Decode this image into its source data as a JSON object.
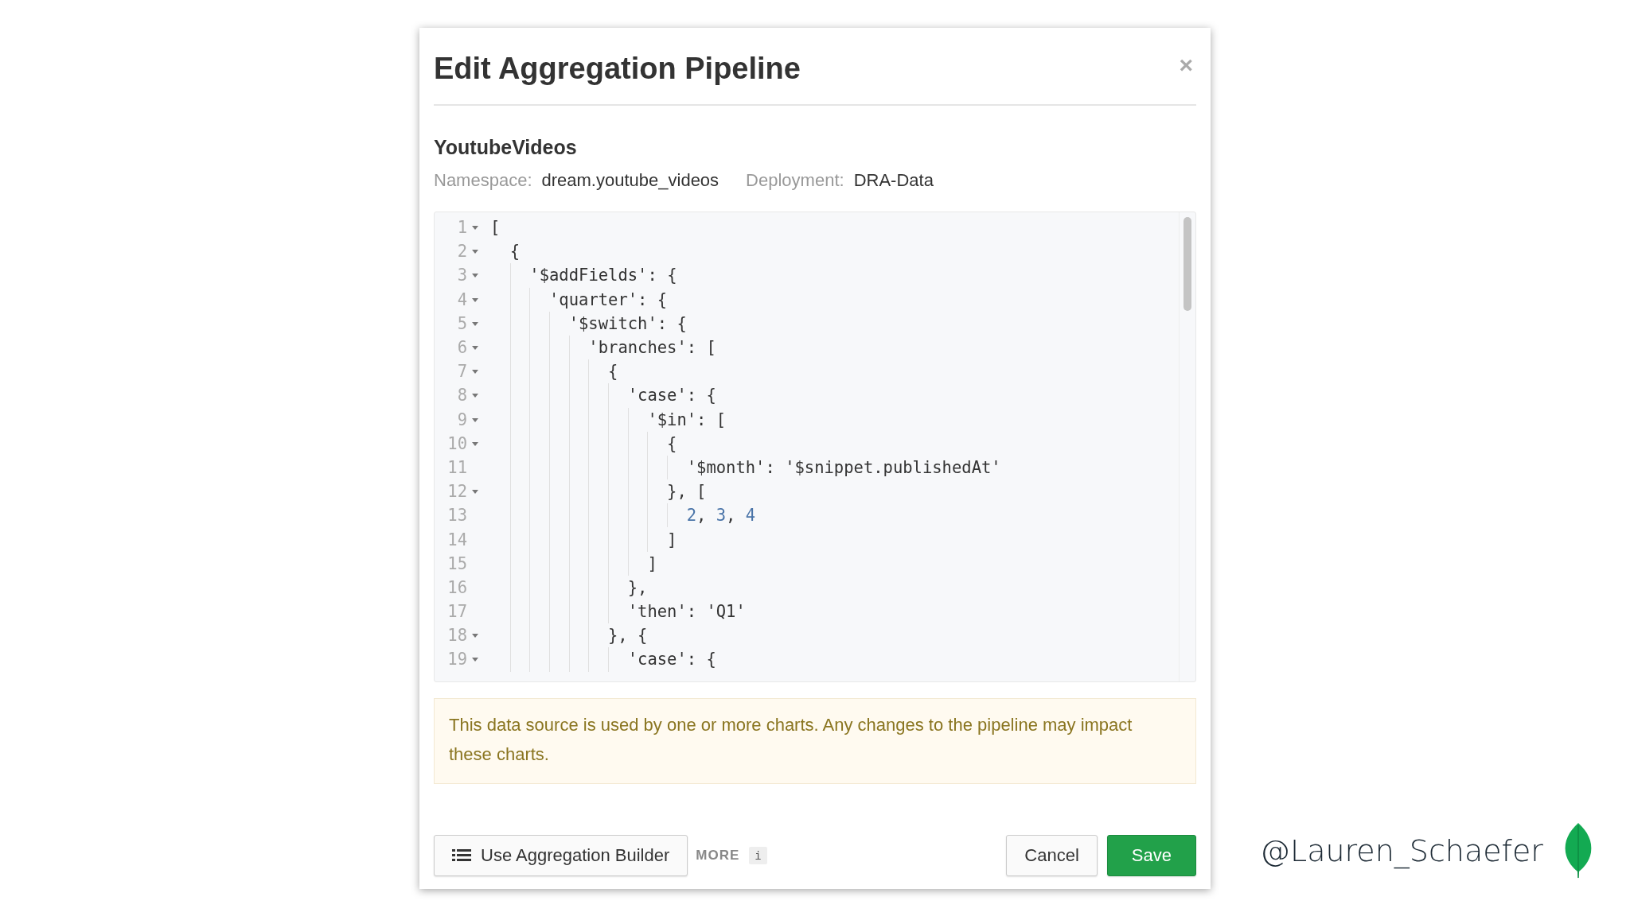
{
  "dialog": {
    "title": "Edit Aggregation Pipeline",
    "close": "×",
    "data_source": {
      "name": "YoutubeVideos",
      "fields": [
        {
          "label": "Namespace:",
          "value": "dream.youtube_videos"
        },
        {
          "label": "Deployment:",
          "value": "DRA-Data"
        }
      ]
    },
    "editor": {
      "lines": [
        {
          "number": "1",
          "foldable": true,
          "text": "[",
          "children": [
            {
              "number": "2",
              "foldable": true,
              "text": "{",
              "children": [
                {
                  "number": "3",
                  "foldable": true,
                  "text": "'$addFields': {",
                  "children": [
                    {
                      "number": "4",
                      "foldable": true,
                      "text": "'quarter': {",
                      "children": [
                        {
                          "number": "5",
                          "foldable": true,
                          "text": "'$switch': {",
                          "children": [
                            {
                              "number": "6",
                              "foldable": true,
                              "text": "'branches': [",
                              "children": [
                                {
                                  "number": "7",
                                  "foldable": true,
                                  "text": "{",
                                  "children": [
                                    {
                                      "number": "8",
                                      "foldable": true,
                                      "text": "'case': {",
                                      "children": [
                                        {
                                          "number": "9",
                                          "foldable": true,
                                          "text": "'$in': [",
                                          "children": [
                                            {
                                              "number": "10",
                                              "foldable": true,
                                              "text": "{",
                                              "children": [
                                                {
                                                  "number": "11",
                                                  "foldable": false,
                                                  "text": "'$month': '$snippet.publishedAt'"
                                                }
                                              ]
                                            },
                                            {
                                              "number": "12",
                                              "foldable": true,
                                              "text": "}, [",
                                              "children": [
                                                {
                                                  "number": "13",
                                                  "foldable": false,
                                                  "parts": [
                                                    {
                                                      "kind": "number",
                                                      "text": "2"
                                                    },
                                                    {
                                                      "kind": "plain",
                                                      "text": ", "
                                                    },
                                                    {
                                                      "kind": "number",
                                                      "text": "3"
                                                    },
                                                    {
                                                      "kind": "plain",
                                                      "text": ", "
                                                    },
                                                    {
                                                      "kind": "number",
                                                      "text": "4"
                                                    }
                                                  ]
                                                }
                                              ]
                                            },
                                            {
                                              "number": "14",
                                              "foldable": false,
                                              "text": "]"
                                            }
                                          ]
                                        },
                                        {
                                          "number": "15",
                                          "foldable": false,
                                          "text": "]"
                                        }
                                      ]
                                    },
                                    {
                                      "number": "16",
                                      "foldable": false,
                                      "text": "},"
                                    },
                                    {
                                      "number": "17",
                                      "foldable": false,
                                      "text": "'then': 'Q1'"
                                    }
                                  ]
                                },
                                {
                                  "number": "18",
                                  "foldable": true,
                                  "text": "}, {",
                                  "children": [
                                    {
                                      "number": "19",
                                      "foldable": true,
                                      "text": "'case': {"
                                    }
                                  ]
                                }
                              ]
                            }
                          ]
                        }
                      ]
                    }
                  ]
                }
              ]
            }
          ]
        }
      ]
    },
    "warning": "This data source is used by one or more charts. Any changes to the pipeline may impact these charts.",
    "footer": {
      "builder_button": "Use Aggregation Builder",
      "more": "MORE",
      "info": "i",
      "cancel": "Cancel",
      "save": "Save"
    }
  },
  "handle": "@Lauren_Schaefer"
}
